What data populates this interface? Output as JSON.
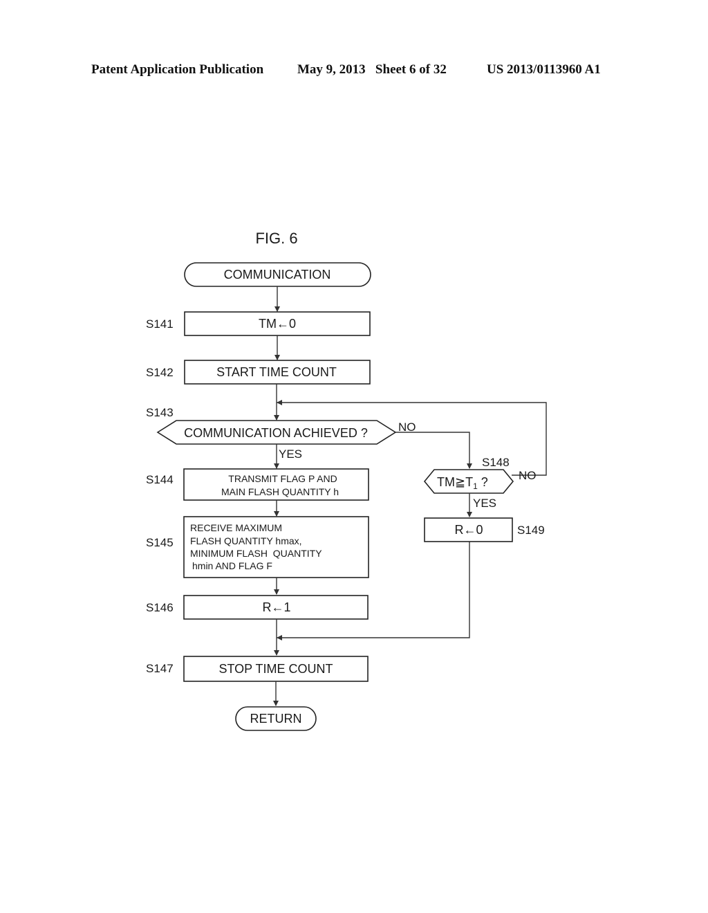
{
  "header": {
    "publication": "Patent Application Publication",
    "date_sheet": "May 9, 2013   Sheet 6 of 32",
    "patent_number": "US 2013/0113960 A1"
  },
  "figure": {
    "title": "FIG. 6",
    "start": "COMMUNICATION",
    "end": "RETURN",
    "steps": {
      "s141": {
        "label": "S141",
        "text": "TM←0"
      },
      "s142": {
        "label": "S142",
        "text": "START TIME COUNT"
      },
      "s143": {
        "label": "S143",
        "text": "COMMUNICATION ACHIEVED ?",
        "yes": "YES",
        "no": "NO"
      },
      "s144": {
        "label": "S144",
        "lines": [
          "TRANSMIT FLAG P AND",
          "MAIN FLASH QUANTITY h"
        ]
      },
      "s145": {
        "label": "S145",
        "lines": [
          "RECEIVE MAXIMUM",
          "FLASH QUANTITY hmax,",
          "MINIMUM FLASH  QUANTITY",
          "hmin AND FLAG F"
        ]
      },
      "s146": {
        "label": "S146",
        "text": "R←1"
      },
      "s147": {
        "label": "S147",
        "text": "STOP TIME COUNT"
      },
      "s148": {
        "label": "S148",
        "text_main": "TM≧T",
        "text_sub": "1",
        "text_tail": " ?",
        "yes": "YES",
        "no": "NO"
      },
      "s149": {
        "label": "S149",
        "text": "R←0"
      }
    }
  }
}
